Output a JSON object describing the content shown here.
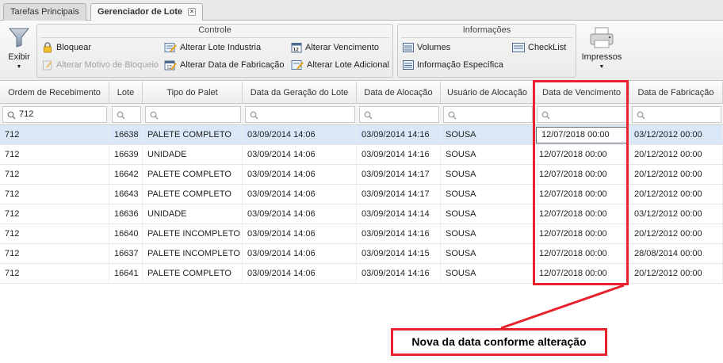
{
  "tabs": [
    {
      "label": "Tarefas Principais",
      "active": false
    },
    {
      "label": "Gerenciador de Lote",
      "active": true,
      "close": "×"
    }
  ],
  "ribbon": {
    "filter_label": "Exibir",
    "groups": {
      "controle": {
        "title": "Controle",
        "items": [
          {
            "label": "Bloquear",
            "icon": "lock-icon",
            "enabled": true
          },
          {
            "label": "Alterar Motivo de Bloqueio",
            "icon": "edit-reason-icon",
            "enabled": false
          },
          {
            "label": "Alterar Lote Industria",
            "icon": "edit-batch-icon",
            "enabled": true
          },
          {
            "label": "Alterar Data de Fabricação",
            "icon": "calendar-edit-icon",
            "enabled": true
          },
          {
            "label": "Alterar Vencimento",
            "icon": "calendar-12-icon",
            "enabled": true
          },
          {
            "label": "Alterar Lote Adicional",
            "icon": "edit-additional-icon",
            "enabled": true
          }
        ]
      },
      "informacoes": {
        "title": "Informações",
        "items": [
          {
            "label": "Volumes",
            "icon": "list-icon"
          },
          {
            "label": "Informação Específica",
            "icon": "list-icon"
          },
          {
            "label": "CheckList",
            "icon": "checklist-icon"
          }
        ]
      }
    },
    "print_label": "Impressos"
  },
  "grid": {
    "columns": [
      "Ordem de Recebimento",
      "Lote",
      "Tipo do Palet",
      "Data da Geração do Lote",
      "Data de Alocação",
      "Usuário de Alocação",
      "Data de Vencimento",
      "Data de Fabricação"
    ],
    "filter_value": "712",
    "rows": [
      [
        "712",
        "16638",
        "PALETE COMPLETO",
        "03/09/2014 14:06",
        "03/09/2014 14:16",
        "SOUSA",
        "12/07/2018 00:00",
        "03/12/2012 00:00"
      ],
      [
        "712",
        "16639",
        "UNIDADE",
        "03/09/2014 14:06",
        "03/09/2014 14:16",
        "SOUSA",
        "12/07/2018 00:00",
        "20/12/2012 00:00"
      ],
      [
        "712",
        "16642",
        "PALETE COMPLETO",
        "03/09/2014 14:06",
        "03/09/2014 14:17",
        "SOUSA",
        "12/07/2018 00:00",
        "20/12/2012 00:00"
      ],
      [
        "712",
        "16643",
        "PALETE COMPLETO",
        "03/09/2014 14:06",
        "03/09/2014 14:17",
        "SOUSA",
        "12/07/2018 00:00",
        "20/12/2012 00:00"
      ],
      [
        "712",
        "16636",
        "UNIDADE",
        "03/09/2014 14:06",
        "03/09/2014 14:14",
        "SOUSA",
        "12/07/2018 00:00",
        "03/12/2012 00:00"
      ],
      [
        "712",
        "16640",
        "PALETE INCOMPLETO",
        "03/09/2014 14:06",
        "03/09/2014 14:16",
        "SOUSA",
        "12/07/2018 00:00",
        "20/12/2012 00:00"
      ],
      [
        "712",
        "16637",
        "PALETE INCOMPLETO",
        "03/09/2014 14:06",
        "03/09/2014 14:15",
        "SOUSA",
        "12/07/2018 00:00",
        "28/08/2014 00:00"
      ],
      [
        "712",
        "16641",
        "PALETE COMPLETO",
        "03/09/2014 14:06",
        "03/09/2014 14:16",
        "SOUSA",
        "12/07/2018 00:00",
        "20/12/2012 00:00"
      ]
    ],
    "selected_row": 0
  },
  "annotation": {
    "callout_text": "Nova da data conforme alteração",
    "color": "#e8232d"
  },
  "colors": {
    "selected_row": "#d9e7f7",
    "accent_blue": "#3a6ea5"
  }
}
